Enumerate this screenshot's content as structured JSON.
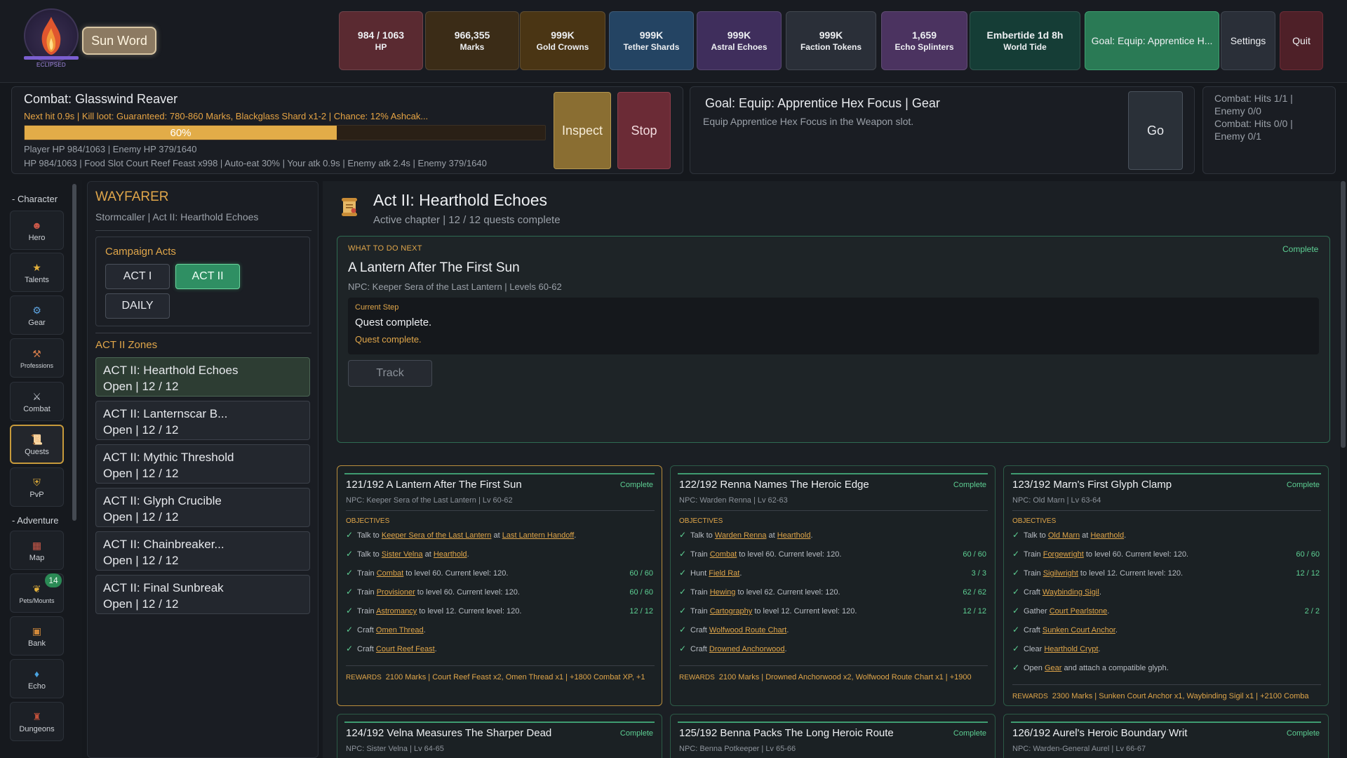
{
  "top": {
    "logo_caption": "ECLIPSED",
    "sun_word": "Sun Word",
    "stats": [
      {
        "value": "984 / 1063",
        "label": "HP",
        "color": "#5a2a31"
      },
      {
        "value": "966,355",
        "label": "Marks",
        "color": "#3b2c17"
      },
      {
        "value": "999K",
        "label": "Gold Crowns",
        "color": "#4a3514"
      },
      {
        "value": "999K",
        "label": "Tether Shards",
        "color": "#244463"
      },
      {
        "value": "999K",
        "label": "Astral Echoes",
        "color": "#3f2e5c"
      },
      {
        "value": "999K",
        "label": "Faction Tokens",
        "color": "#2a2f38"
      },
      {
        "value": "1,659",
        "label": "Echo Splinters",
        "color": "#4b3360"
      },
      {
        "value": "Embertide 1d 8h",
        "label": "World Tide",
        "color": "#153d36"
      }
    ],
    "goal_button": "Goal: Equip: Apprentice H...",
    "settings": "Settings",
    "quit": "Quit"
  },
  "combat": {
    "title": "Combat: Glasswind Reaver",
    "info": "Next hit 0.9s | Kill loot: Guaranteed: 780-860 Marks, Blackglass Shard x1-2 | Chance: 12% Ashcak...",
    "progress": 0.6,
    "progress_label": "60%",
    "hp_line": "Player HP 984/1063 | Enemy HP 379/1640",
    "detail_line": "HP 984/1063 | Food Slot Court Reef Feast x998 | Auto-eat 30% | Your atk 0.9s | Enemy atk 2.4s | Enemy 379/1640",
    "inspect": "Inspect",
    "stop": "Stop"
  },
  "goal": {
    "title": "Goal: Equip: Apprentice Hex Focus | Gear",
    "desc": "Equip Apprentice Hex Focus in the Weapon slot.",
    "go": "Go"
  },
  "hits": {
    "lines": [
      "Combat: Hits 1/1 |",
      "Enemy 0/0",
      "Combat: Hits 0/0 |",
      "Enemy 0/1"
    ]
  },
  "nav": {
    "character_caption": "- Character",
    "adventure_caption": "- Adventure",
    "character": [
      {
        "label": "Hero",
        "icon": "hero-icon",
        "glyph": "☻",
        "color": "#d05a4a"
      },
      {
        "label": "Talents",
        "icon": "star-icon",
        "glyph": "★",
        "color": "#e3b03b"
      },
      {
        "label": "Gear",
        "icon": "gear-icon",
        "glyph": "⚙",
        "color": "#5da3e0"
      },
      {
        "label": "Professions",
        "icon": "pickaxe-icon",
        "glyph": "⚒",
        "color": "#d07a4a"
      },
      {
        "label": "Combat",
        "icon": "crossed-swords-icon",
        "glyph": "⚔",
        "color": "#c9ced6"
      },
      {
        "label": "Quests",
        "icon": "scroll-icon",
        "glyph": "📜",
        "color": "#e0a64a"
      },
      {
        "label": "PvP",
        "icon": "shield-icon",
        "glyph": "⛨",
        "color": "#e3b03b"
      }
    ],
    "adventure": [
      {
        "label": "Map",
        "icon": "map-icon",
        "glyph": "▦",
        "color": "#d05a4a"
      },
      {
        "label": "Pets/Mounts",
        "icon": "paw-icon",
        "glyph": "❦",
        "color": "#e3b03b"
      },
      {
        "label": "Bank",
        "icon": "chest-icon",
        "glyph": "▣",
        "color": "#d0883a"
      },
      {
        "label": "Echo",
        "icon": "crystal-icon",
        "glyph": "♦",
        "color": "#4aa3e0"
      },
      {
        "label": "Dungeons",
        "icon": "dungeon-icon",
        "glyph": "♜",
        "color": "#c0503a"
      }
    ],
    "pets_badge": "14"
  },
  "zones": {
    "heading": "WAYFARER",
    "subtitle": "Stormcaller | Act II: Hearthold Echoes",
    "acts_title": "Campaign Acts",
    "acts": [
      "ACT I",
      "ACT II",
      "DAILY"
    ],
    "zones_title": "ACT II Zones",
    "list": [
      {
        "name": "ACT II: Hearthold Echoes",
        "status": "Open | 12 / 12"
      },
      {
        "name": "ACT II: Lanternscar B...",
        "status": "Open | 12 / 12"
      },
      {
        "name": "ACT II: Mythic Threshold",
        "status": "Open | 12 / 12"
      },
      {
        "name": "ACT II: Glyph Crucible",
        "status": "Open | 12 / 12"
      },
      {
        "name": "ACT II: Chainbreaker...",
        "status": "Open | 12 / 12"
      },
      {
        "name": "ACT II: Final Sunbreak",
        "status": "Open | 12 / 12"
      }
    ]
  },
  "chapter": {
    "title": "Act II: Hearthold Echoes",
    "subtitle": "Active chapter | 12 / 12 quests complete"
  },
  "next": {
    "caption": "WHAT TO DO NEXT",
    "status": "Complete",
    "title": "A Lantern After The First Sun",
    "npc": "NPC: Keeper Sera of the Last Lantern | Levels 60-62",
    "step_caption": "Current Step",
    "step_text": "Quest complete.",
    "step_sub": "Quest complete.",
    "track": "Track"
  },
  "cards": [
    {
      "title": "121/192  A Lantern After The First Sun",
      "status": "Complete",
      "npc": "NPC: Keeper Sera of the Last Lantern | Lv 60-62",
      "obj_caption": "OBJECTIVES",
      "objectives": [
        {
          "parts": [
            [
              "Talk to ",
              0
            ],
            [
              "Keeper Sera of the Last Lantern",
              1
            ],
            [
              " at ",
              0
            ],
            [
              "Last Lantern Handoff",
              1
            ],
            [
              ".",
              0
            ]
          ],
          "progress": ""
        },
        {
          "parts": [
            [
              "Talk to ",
              0
            ],
            [
              "Sister Velna",
              1
            ],
            [
              " at ",
              0
            ],
            [
              "Hearthold",
              1
            ],
            [
              ".",
              0
            ]
          ],
          "progress": ""
        },
        {
          "parts": [
            [
              "Train ",
              0
            ],
            [
              "Combat",
              1
            ],
            [
              " to level 60. Current level: 120.",
              0
            ]
          ],
          "progress": "60 / 60"
        },
        {
          "parts": [
            [
              "Train ",
              0
            ],
            [
              "Provisioner",
              1
            ],
            [
              " to level 60. Current level: 120.",
              0
            ]
          ],
          "progress": "60 / 60"
        },
        {
          "parts": [
            [
              "Train ",
              0
            ],
            [
              "Astromancy",
              1
            ],
            [
              " to level 12. Current level: 120.",
              0
            ]
          ],
          "progress": "12 / 12"
        },
        {
          "parts": [
            [
              "Craft ",
              0
            ],
            [
              "Omen Thread",
              1
            ],
            [
              ".",
              0
            ]
          ],
          "progress": ""
        },
        {
          "parts": [
            [
              "Craft ",
              0
            ],
            [
              "Court Reef Feast",
              1
            ],
            [
              ".",
              0
            ]
          ],
          "progress": ""
        }
      ],
      "rewards_caption": "REWARDS",
      "rewards": "2100 Marks | Court Reef Feast x2, Omen Thread x1 | +1800 Combat XP, +1"
    },
    {
      "title": "122/192  Renna Names The Heroic Edge",
      "status": "Complete",
      "npc": "NPC: Warden Renna | Lv 62-63",
      "obj_caption": "OBJECTIVES",
      "objectives": [
        {
          "parts": [
            [
              "Talk to ",
              0
            ],
            [
              "Warden Renna",
              1
            ],
            [
              " at ",
              0
            ],
            [
              "Hearthold",
              1
            ],
            [
              ".",
              0
            ]
          ],
          "progress": ""
        },
        {
          "parts": [
            [
              "Train ",
              0
            ],
            [
              "Combat",
              1
            ],
            [
              " to level 60. Current level: 120.",
              0
            ]
          ],
          "progress": "60 / 60"
        },
        {
          "parts": [
            [
              "Hunt ",
              0
            ],
            [
              "Field Rat",
              1
            ],
            [
              ".",
              0
            ]
          ],
          "progress": "3 / 3"
        },
        {
          "parts": [
            [
              "Train ",
              0
            ],
            [
              "Hewing",
              1
            ],
            [
              " to level 62. Current level: 120.",
              0
            ]
          ],
          "progress": "62 / 62"
        },
        {
          "parts": [
            [
              "Train ",
              0
            ],
            [
              "Cartography",
              1
            ],
            [
              " to level 12. Current level: 120.",
              0
            ]
          ],
          "progress": "12 / 12"
        },
        {
          "parts": [
            [
              "Craft ",
              0
            ],
            [
              "Wolfwood Route Chart",
              1
            ],
            [
              ".",
              0
            ]
          ],
          "progress": ""
        },
        {
          "parts": [
            [
              "Craft ",
              0
            ],
            [
              "Drowned Anchorwood",
              1
            ],
            [
              ".",
              0
            ]
          ],
          "progress": ""
        }
      ],
      "rewards_caption": "REWARDS",
      "rewards": "2100 Marks | Drowned Anchorwood x2, Wolfwood Route Chart x1 | +1900"
    },
    {
      "title": "123/192  Marn's First Glyph Clamp",
      "status": "Complete",
      "npc": "NPC: Old Marn | Lv 63-64",
      "obj_caption": "OBJECTIVES",
      "objectives": [
        {
          "parts": [
            [
              "Talk to ",
              0
            ],
            [
              "Old Marn",
              1
            ],
            [
              " at ",
              0
            ],
            [
              "Hearthold",
              1
            ],
            [
              ".",
              0
            ]
          ],
          "progress": ""
        },
        {
          "parts": [
            [
              "Train ",
              0
            ],
            [
              "Forgewright",
              1
            ],
            [
              " to level 60. Current level: 120.",
              0
            ]
          ],
          "progress": "60 / 60"
        },
        {
          "parts": [
            [
              "Train ",
              0
            ],
            [
              "Sigilwright",
              1
            ],
            [
              " to level 12. Current level: 120.",
              0
            ]
          ],
          "progress": "12 / 12"
        },
        {
          "parts": [
            [
              "Craft ",
              0
            ],
            [
              "Waybinding Sigil",
              1
            ],
            [
              ".",
              0
            ]
          ],
          "progress": ""
        },
        {
          "parts": [
            [
              "Gather ",
              0
            ],
            [
              "Court Pearlstone",
              1
            ],
            [
              ".",
              0
            ]
          ],
          "progress": "2 / 2"
        },
        {
          "parts": [
            [
              "Craft ",
              0
            ],
            [
              "Sunken Court Anchor",
              1
            ],
            [
              ".",
              0
            ]
          ],
          "progress": ""
        },
        {
          "parts": [
            [
              "Clear ",
              0
            ],
            [
              "Hearthold Crypt",
              1
            ],
            [
              ".",
              0
            ]
          ],
          "progress": ""
        },
        {
          "parts": [
            [
              "Open ",
              0
            ],
            [
              "Gear",
              1
            ],
            [
              " and attach a compatible glyph.",
              0
            ]
          ],
          "progress": ""
        }
      ],
      "rewards_caption": "REWARDS",
      "rewards": "2300 Marks | Sunken Court Anchor x1, Waybinding Sigil x1 | +2100 Comba"
    },
    {
      "title": "124/192  Velna Measures The Sharper Dead",
      "status": "Complete",
      "npc": "NPC: Sister Velna | Lv 64-65",
      "obj_caption": "",
      "objectives": [],
      "rewards_caption": "",
      "rewards": ""
    },
    {
      "title": "125/192  Benna Packs The Long Heroic Route",
      "status": "Complete",
      "npc": "NPC: Benna Potkeeper | Lv 65-66",
      "obj_caption": "",
      "objectives": [],
      "rewards_caption": "",
      "rewards": ""
    },
    {
      "title": "126/192  Aurel's Heroic Boundary Writ",
      "status": "Complete",
      "npc": "NPC: Warden-General Aurel | Lv 66-67",
      "obj_caption": "",
      "objectives": [],
      "rewards_caption": "",
      "rewards": ""
    }
  ]
}
